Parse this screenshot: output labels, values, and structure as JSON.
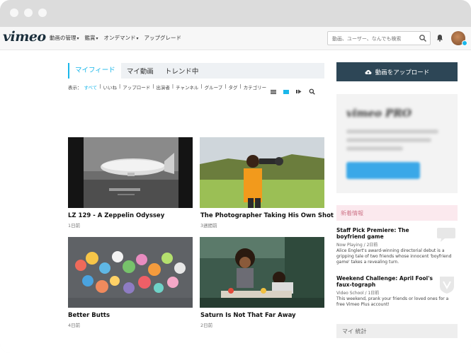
{
  "header": {
    "logo": "vimeo",
    "nav": [
      {
        "label": "動画の管理"
      },
      {
        "label": "鑑賞"
      },
      {
        "label": "オンデマンド"
      },
      {
        "label": "アップグレード"
      }
    ],
    "search_placeholder": "動画、ユーザー、なんでも検索"
  },
  "tabs": [
    {
      "label": "マイフィード"
    },
    {
      "label": "マイ動画"
    },
    {
      "label": "トレンド中"
    }
  ],
  "filters": {
    "label": "表示：",
    "items": [
      "すべて",
      "いいね",
      "アップロード",
      "出演者",
      "チャンネル",
      "グループ",
      "タグ",
      "カテゴリー"
    ]
  },
  "videos": [
    {
      "title": "LZ 129 - A Zeppelin Odyssey",
      "meta": "1日前"
    },
    {
      "title": "The Photographer Taking His Own Shot",
      "meta": "3週間前"
    },
    {
      "title": "Better Butts",
      "meta": "4日前"
    },
    {
      "title": "Saturn Is Not That Far Away",
      "meta": "2日前"
    }
  ],
  "sidebar": {
    "upload_label": "動画をアップロード",
    "promo_logo": "vimeo PRO",
    "news_heading": "新着情報",
    "news": [
      {
        "title": "Staff Pick Premiere: The boyfriend game",
        "sub": "Now Playing / 2日前",
        "body": "Alice Englert's award-winning directorial debut is a gripping tale of two friends whose innocent 'boyfriend game' takes a revealing turn."
      },
      {
        "title": "Weekend Challenge: April Fool's faux-tograph",
        "sub": "Video School / 1日前",
        "body": "This weekend, prank your friends or loved ones for a free Vimeo Plus account!"
      }
    ],
    "stats_label": "マイ 統計"
  },
  "colors": {
    "accent": "#1ab7ea",
    "upload_bg": "#2d4656",
    "news_bg": "#fbe9ee"
  }
}
